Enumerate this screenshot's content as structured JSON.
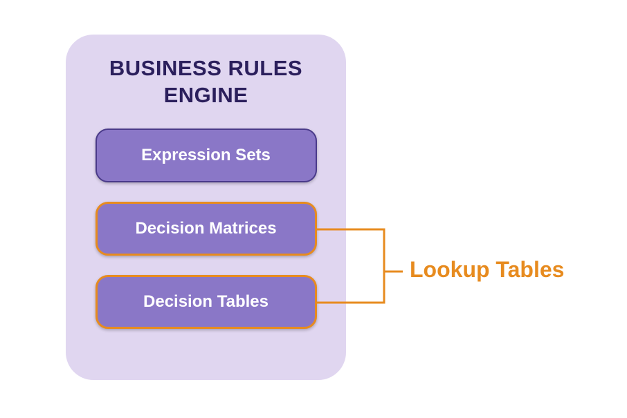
{
  "diagram": {
    "container_title_line1": "BUSINESS RULES",
    "container_title_line2": "ENGINE",
    "components": {
      "expression_sets": {
        "label": "Expression Sets",
        "highlighted": false
      },
      "decision_matrices": {
        "label": "Decision Matrices",
        "highlighted": true
      },
      "decision_tables": {
        "label": "Decision Tables",
        "highlighted": true
      }
    },
    "lookup_label": "Lookup Tables",
    "colors": {
      "container_bg": "#e0d6f0",
      "title_text": "#2b1f5c",
      "box_bg": "#8a77c7",
      "box_border_normal": "#4a3a8a",
      "highlight": "#e78b1f",
      "box_text": "#ffffff"
    }
  }
}
